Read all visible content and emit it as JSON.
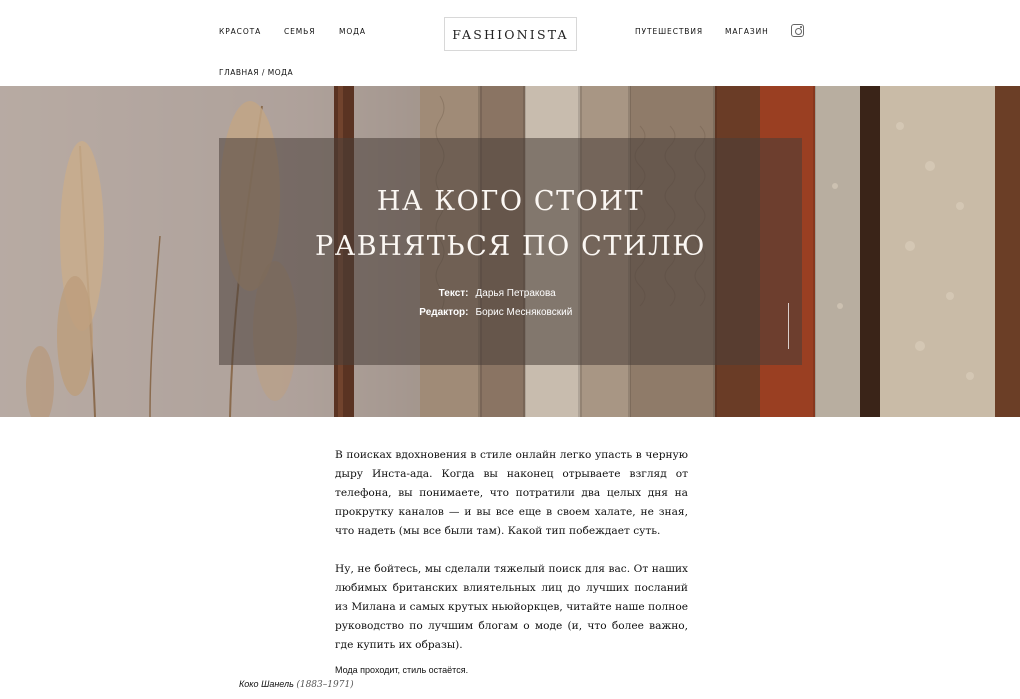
{
  "header": {
    "nav_left": [
      {
        "label": "КРАСОТА"
      },
      {
        "label": "СЕМЬЯ"
      },
      {
        "label": "МОДА"
      }
    ],
    "logo": "FASHIONISTA",
    "nav_right": [
      {
        "label": "ПУТЕШЕСТВИЯ"
      },
      {
        "label": "МАГАЗИН"
      }
    ],
    "social_icon": "instagram-icon"
  },
  "breadcrumb": {
    "home": "ГЛАВНАЯ",
    "separator": " / ",
    "current": "МОДА"
  },
  "hero": {
    "title_line1": "НА КОГО СТОИТ",
    "title_line2": "РАВНЯТЬСЯ ПО СТИЛЮ",
    "author_label": "Текст:",
    "author_name": "Дарья Петракова",
    "editor_label": "Редактор:",
    "editor_name": "Борис Месняковский"
  },
  "article": {
    "paragraph1": "В поисках вдохновения в стиле онлайн легко упасть в черную дыру Инста-ада. Когда вы наконец отрываете взгляд от телефона, вы понимаете, что потратили два целых дня на прокрутку каналов — и вы все еще в своем халате, не зная, что надеть (мы все были там). Какой тип побеждает суть.",
    "paragraph2": "Ну, не бойтесь, мы сделали тяжелый поиск для вас. От наших любимых британских влиятельных лиц до лучших посланий из Милана и самых крутых ньюйоркцев, читайте наше полное руководство по лучшим блогам о моде (и, что более важно, где купить их образы).",
    "quote": "Мода проходит, стиль остаётся.",
    "quote_author": "Коко Шанель",
    "quote_years": "(1883–1971)"
  },
  "colors": {
    "text": "#111111",
    "hero_overlay": "#483e38",
    "hero_text": "#fbf7f3"
  }
}
